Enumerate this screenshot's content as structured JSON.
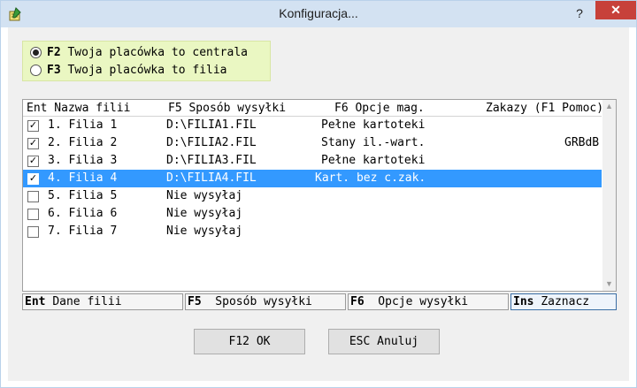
{
  "window": {
    "title": "Konfiguracja...",
    "help_label": "?",
    "close_label": "✕",
    "app_icon": "pencil-notepad-icon"
  },
  "mode": {
    "options": [
      {
        "key": "F2",
        "label": "Twoja placówka to centrala",
        "selected": true
      },
      {
        "key": "F3",
        "label": "Twoja placówka to filia",
        "selected": false
      }
    ]
  },
  "list": {
    "columns": {
      "name": "Ent Nazwa filii",
      "send": "F5 Sposób wysyłki",
      "opts": "F6 Opcje mag.",
      "orders": "Zakazy (F1 Pomoc)"
    },
    "rows": [
      {
        "checked": true,
        "name": "1. Filia 1",
        "send": "D:\\FILIA1.FIL",
        "opts": "Pełne kartoteki",
        "orders": ""
      },
      {
        "checked": true,
        "name": "2. Filia 2",
        "send": "D:\\FILIA2.FIL",
        "opts": "Stany il.-wart.",
        "orders": "GRBdB"
      },
      {
        "checked": true,
        "name": "3. Filia 3",
        "send": "D:\\FILIA3.FIL",
        "opts": "Pełne kartoteki",
        "orders": ""
      },
      {
        "checked": true,
        "name": "4. Filia 4",
        "send": "D:\\FILIA4.FIL",
        "opts": "Kart. bez c.zak.",
        "orders": "",
        "selected": true
      },
      {
        "checked": false,
        "name": "5. Filia 5",
        "send": "Nie wysyłaj",
        "opts": "",
        "orders": ""
      },
      {
        "checked": false,
        "name": "6. Filia 6",
        "send": "Nie wysyłaj",
        "opts": "",
        "orders": ""
      },
      {
        "checked": false,
        "name": "7. Filia 7",
        "send": "Nie wysyłaj",
        "opts": "",
        "orders": ""
      }
    ]
  },
  "fkeys": [
    {
      "key": "Ent",
      "label": "Dane filii"
    },
    {
      "key": "F5",
      "label": "  Sposób wysyłki"
    },
    {
      "key": "F6",
      "label": "  Opcje wysyłki"
    },
    {
      "key": "Ins",
      "label": "Zaznacz"
    }
  ],
  "buttons": {
    "ok": "F12 OK",
    "cancel": "ESC Anuluj"
  },
  "colors": {
    "selection": "#3399ff",
    "mode_panel": "#eaf7c2",
    "close": "#c7413a"
  }
}
